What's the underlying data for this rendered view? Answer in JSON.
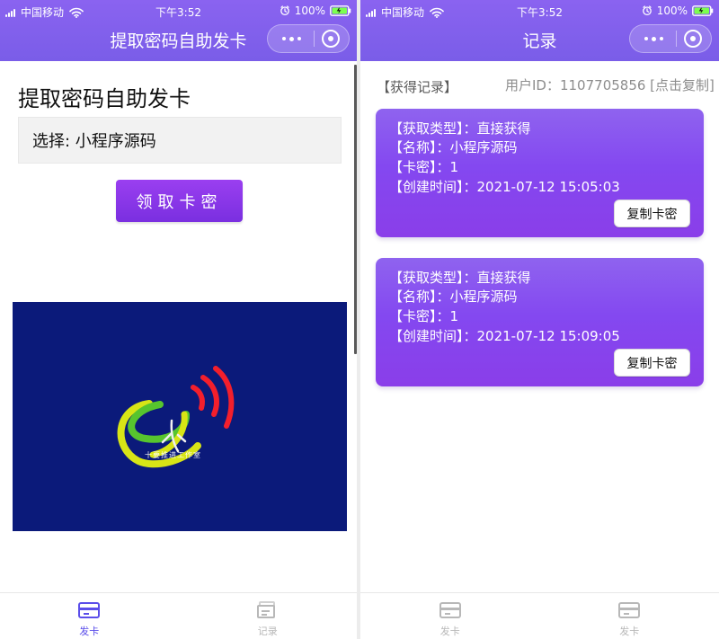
{
  "left": {
    "status": {
      "carrier": "中国移动",
      "time": "下午3:52",
      "battery": "100%"
    },
    "title": "提取密码自助发卡",
    "page": {
      "heading": "提取密码自助发卡",
      "select_label": "选择: 小程序源码",
      "claim_button": "领取卡密",
      "banner_caption": "十要推进工作室"
    },
    "tabs": [
      {
        "label": "发卡",
        "active": true,
        "icon": "card-icon"
      },
      {
        "label": "记录",
        "active": false,
        "icon": "record-icon"
      }
    ]
  },
  "right": {
    "status": {
      "carrier": "中国移动",
      "time": "下午3:52",
      "battery": "100%"
    },
    "title": "记录",
    "page": {
      "records_label": "【获得记录】",
      "userid_text": "用户ID：1107705856 [点击复制]",
      "records": [
        {
          "type_line": "【获取类型】：直接获得",
          "name_line": "【名称】：小程序源码",
          "secret_line": "【卡密】：1",
          "created_line": "【创建时间】：2021-07-12 15:05:03",
          "copy_label": "复制卡密"
        },
        {
          "type_line": "【获取类型】：直接获得",
          "name_line": "【名称】：小程序源码",
          "secret_line": "【卡密】：1",
          "created_line": "【创建时间】：2021-07-12 15:09:05",
          "copy_label": "复制卡密"
        }
      ]
    },
    "tabs": [
      {
        "label": "发卡",
        "active": false,
        "icon": "card-icon"
      },
      {
        "label": "发卡",
        "active": false,
        "icon": "card-icon"
      }
    ]
  },
  "colors": {
    "header": "#7a5de8",
    "accent": "#8f3ef0",
    "active_tab": "#5b4eea",
    "inactive_tab": "#b8b8b8"
  }
}
